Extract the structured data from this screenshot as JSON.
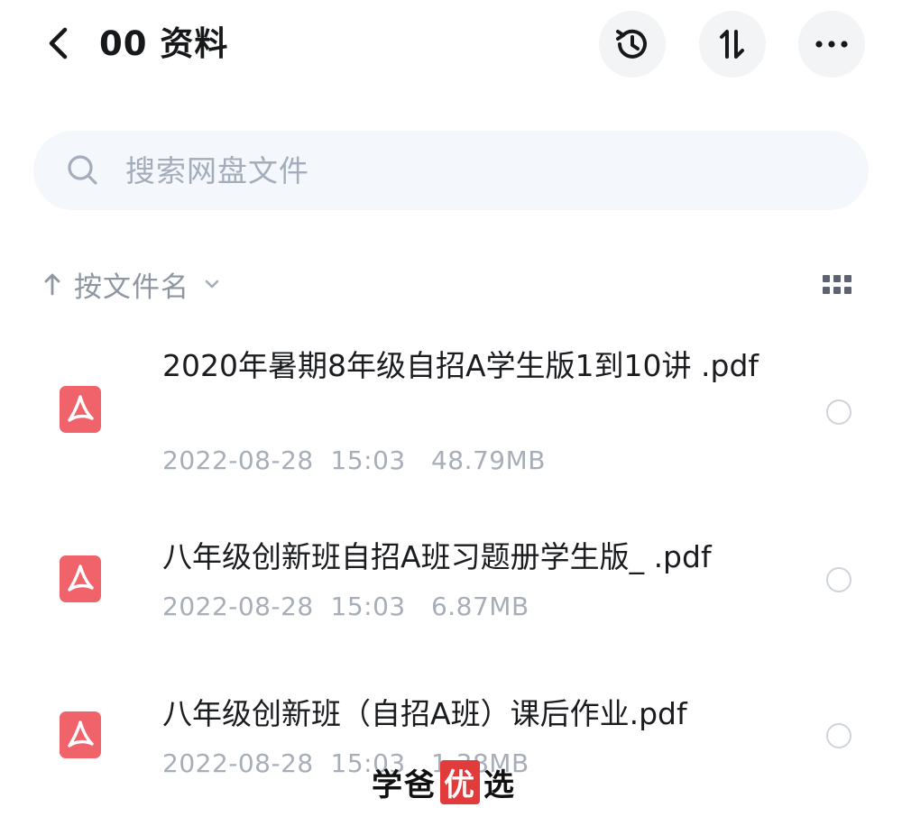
{
  "header": {
    "title": "00 资料",
    "back_icon": "chevron-left-icon",
    "history_icon": "history-icon",
    "sort_icon": "sort-icon",
    "more_icon": "more-icon"
  },
  "search": {
    "placeholder": "搜索网盘文件",
    "icon": "search-icon"
  },
  "sort": {
    "label": "按文件名",
    "direction_icon": "arrow-up-icon",
    "dropdown_icon": "chevron-down-icon",
    "view_toggle_icon": "grid-icon"
  },
  "files": [
    {
      "name": "2020年暑期8年级自招A学生版1到10讲 .pdf",
      "date": "2022-08-28",
      "time": "15:03",
      "size": "48.79MB",
      "icon": "pdf-icon"
    },
    {
      "name": "八年级创新班自招A班习题册学生版_ .pdf",
      "date": "2022-08-28",
      "time": "15:03",
      "size": "6.87MB",
      "icon": "pdf-icon"
    },
    {
      "name": "八年级创新班（自招A班）课后作业.pdf",
      "date": "2022-08-28",
      "time": "15:03",
      "size": "1.38MB",
      "icon": "pdf-icon"
    }
  ],
  "watermark": {
    "part1": "学爸",
    "part2": "优",
    "part3": "选"
  },
  "colors": {
    "pdf_red": "#f0636b",
    "muted": "#a7aeb8",
    "search_bg": "#f4f7fb"
  }
}
